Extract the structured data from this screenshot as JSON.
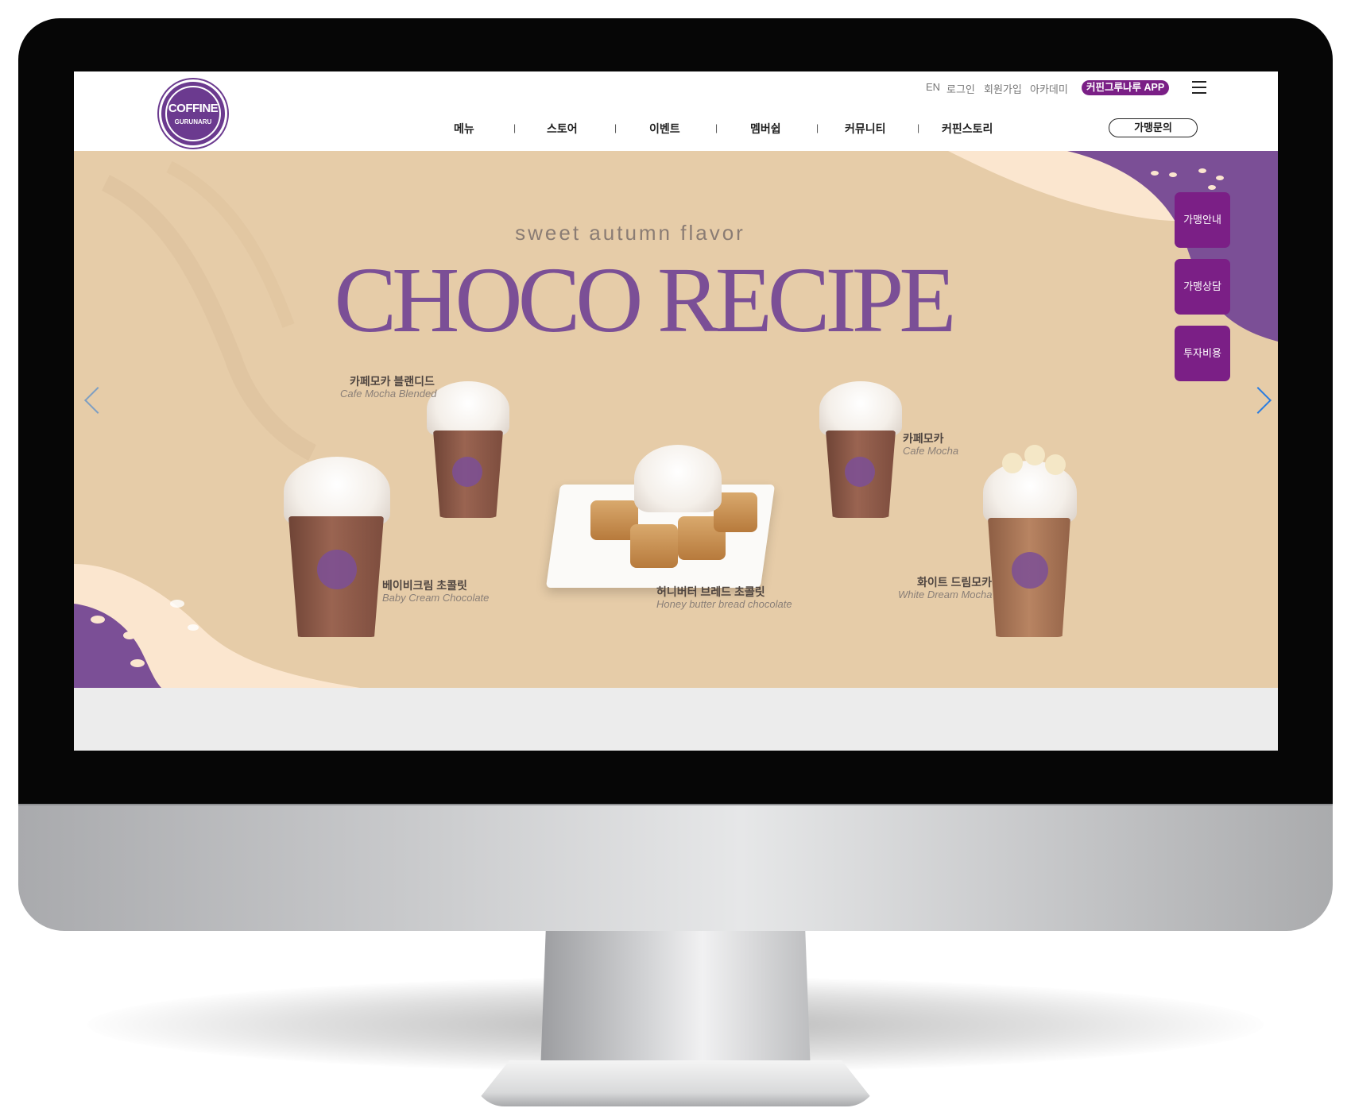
{
  "header": {
    "logo": {
      "word": "COFFINE",
      "sub": "GURUNARU"
    },
    "top_links": {
      "lang": "EN",
      "login": "로그인",
      "signup": "회원가입",
      "academy": "아카데미",
      "app": "커핀그루나루 APP"
    },
    "nav": [
      "메뉴",
      "스토어",
      "이벤트",
      "멤버쉽",
      "커뮤니티",
      "커핀스토리"
    ],
    "nav_separator": "|",
    "inquiry_button": "가맹문의",
    "menu_icon": "hamburger-icon"
  },
  "banner": {
    "tagline": "sweet autumn flavor",
    "headline": "CHOCO RECIPE",
    "products": [
      {
        "ko": "카페모카 블랜디드",
        "en": "Cafe Mocha Blended"
      },
      {
        "ko": "베이비크림 초콜릿",
        "en": "Baby Cream Chocolate"
      },
      {
        "ko": "허니버터 브레드 초콜릿",
        "en": "Honey butter bread chocolate"
      },
      {
        "ko": "카페모카",
        "en": "Cafe Mocha"
      },
      {
        "ko": "화이트 드림모카",
        "en": "White Dream Mocha"
      }
    ],
    "side_buttons": [
      "가맹안내",
      "가맹상담",
      "투자비용"
    ],
    "prev_icon": "chevron-left-icon",
    "next_icon": "chevron-right-icon"
  },
  "colors": {
    "brand_purple": "#7b4f96",
    "button_purple": "#7b1f86",
    "banner_beige": "#e6cca8",
    "cream": "#fbe6cf"
  }
}
